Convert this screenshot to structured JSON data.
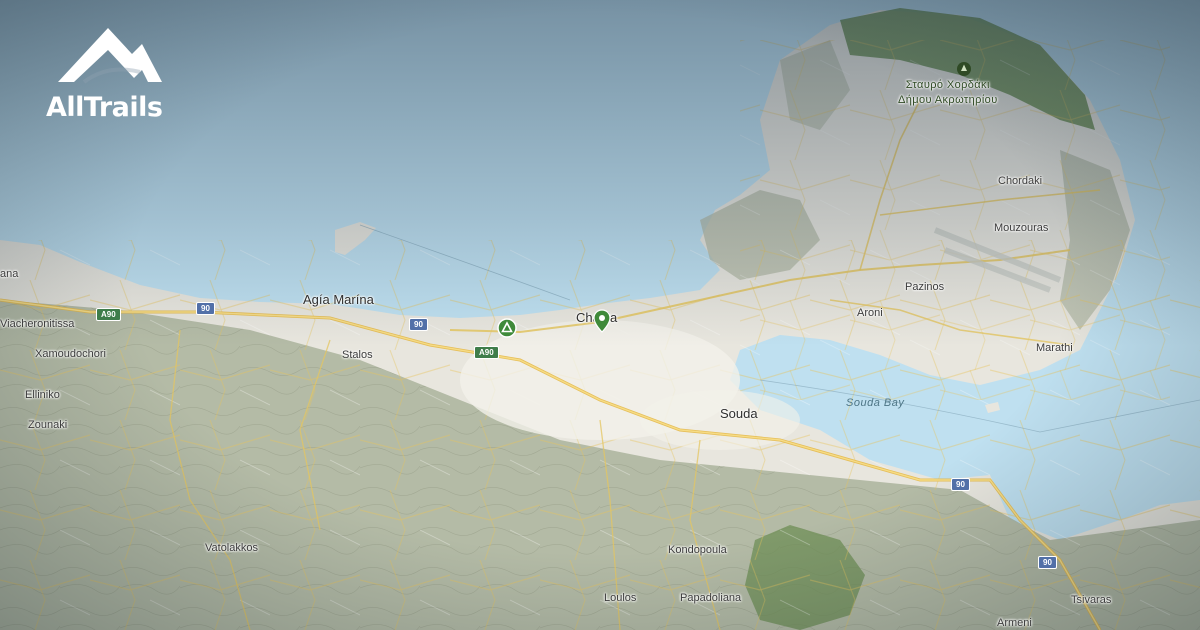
{
  "brand": {
    "name": "AllTrails"
  },
  "map": {
    "places": [
      {
        "id": "chania",
        "name": "Chania"
      },
      {
        "id": "souda",
        "name": "Souda"
      },
      {
        "id": "agia-marina",
        "name": "Agía Marína"
      },
      {
        "id": "stalos",
        "name": "Stalos"
      },
      {
        "id": "viacheronitissa",
        "name": "Viacheronitissa"
      },
      {
        "id": "xamoudochori",
        "name": "Xamoudochori"
      },
      {
        "id": "elliniko",
        "name": "Elliniko"
      },
      {
        "id": "zounaki",
        "name": "Zounaki"
      },
      {
        "id": "vatolakkos",
        "name": "Vatolakkos"
      },
      {
        "id": "kondopoula",
        "name": "Kondopoula"
      },
      {
        "id": "loulos",
        "name": "Loulos"
      },
      {
        "id": "papadoliana",
        "name": "Papadoliana"
      },
      {
        "id": "armeni",
        "name": "Armeni"
      },
      {
        "id": "tsivaras",
        "name": "Tsivaras"
      },
      {
        "id": "chordaki",
        "name": "Chordaki"
      },
      {
        "id": "mouzouras",
        "name": "Mouzouras"
      },
      {
        "id": "pazinos",
        "name": "Pazinos"
      },
      {
        "id": "aroni",
        "name": "Aroni"
      },
      {
        "id": "marathi",
        "name": "Marathi"
      },
      {
        "id": "partial-left",
        "name": "ana"
      }
    ],
    "water": {
      "souda_bay": "Souda Bay"
    },
    "park": {
      "line1": "Σταυρό Χορδάκι",
      "line2": "Δήμου Ακρωτηρίου"
    },
    "road_shields": {
      "a90_west": "A90",
      "r90_west": "90",
      "r90_mid": "90",
      "a90_mid": "A90",
      "r90_east": "90",
      "r90_far_east": "90"
    },
    "colors": {
      "water": "#bfe0f0",
      "land": "#e9e7df",
      "terrain": "#a9b09a",
      "road": "#e8c968",
      "park": "#6f8f55",
      "marker": "#3f8a3a"
    }
  }
}
